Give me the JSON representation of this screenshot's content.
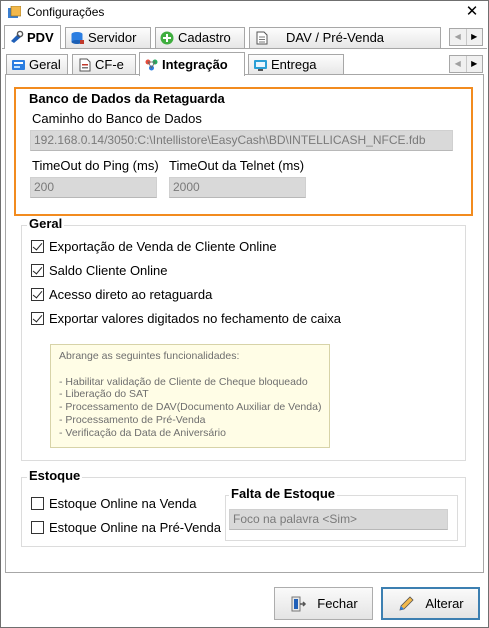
{
  "window": {
    "title": "Configurações",
    "close_glyph": "✕"
  },
  "main_tabs": [
    {
      "label": "PDV",
      "icon": "pdv-icon",
      "active": true
    },
    {
      "label": "Servidor",
      "icon": "server-icon",
      "active": false
    },
    {
      "label": "Cadastro",
      "icon": "add-icon",
      "active": false
    },
    {
      "label": "DAV / Pré-Venda",
      "icon": "document-icon",
      "active": false
    }
  ],
  "sub_tabs": [
    {
      "label": "Geral",
      "icon": "general-icon",
      "active": false
    },
    {
      "label": "CF-e",
      "icon": "cfe-icon",
      "active": false
    },
    {
      "label": "Integração",
      "icon": "integration-icon",
      "active": true
    },
    {
      "label": "Entrega",
      "icon": "delivery-icon",
      "active": false
    }
  ],
  "scroll": {
    "left": "◀",
    "right": "▶"
  },
  "banco": {
    "title": "Banco de Dados da Retaguarda",
    "caminho_label": "Caminho do Banco de Dados",
    "caminho_value": "192.168.0.14/3050:C:\\Intellistore\\EasyCash\\BD\\INTELLICASH_NFCE.fdb",
    "ping_label": "TimeOut do Ping (ms)",
    "ping_value": "200",
    "telnet_label": "TimeOut da Telnet (ms)",
    "telnet_value": "2000"
  },
  "geral": {
    "title": "Geral",
    "options": [
      {
        "label": "Exportação de Venda de Cliente Online",
        "checked": true
      },
      {
        "label": "Saldo Cliente Online",
        "checked": true
      },
      {
        "label": "Acesso direto ao retaguarda",
        "checked": true
      },
      {
        "label": "Exportar valores digitados no fechamento de caixa",
        "checked": true
      }
    ],
    "note_lines": [
      "Abrange as seguintes funcionalidades:",
      "",
      "- Habilitar validação de Cliente de Cheque bloqueado",
      "- Liberação do SAT",
      "- Processamento de DAV(Documento Auxiliar de Venda)",
      "- Processamento de Pré-Venda",
      "- Verificação da Data de Aniversário"
    ]
  },
  "estoque": {
    "title": "Estoque",
    "options": [
      {
        "label": "Estoque Online na Venda",
        "checked": false
      },
      {
        "label": "Estoque Online na Pré-Venda",
        "checked": false
      }
    ],
    "falta_title": "Falta de Estoque",
    "falta_value": "Foco na palavra <Sim>"
  },
  "buttons": {
    "fechar": "Fechar",
    "alterar": "Alterar"
  },
  "colors": {
    "highlight": "#f28b1f",
    "primary_border": "#3c7fb1",
    "field_bg": "#d9d9d9"
  }
}
